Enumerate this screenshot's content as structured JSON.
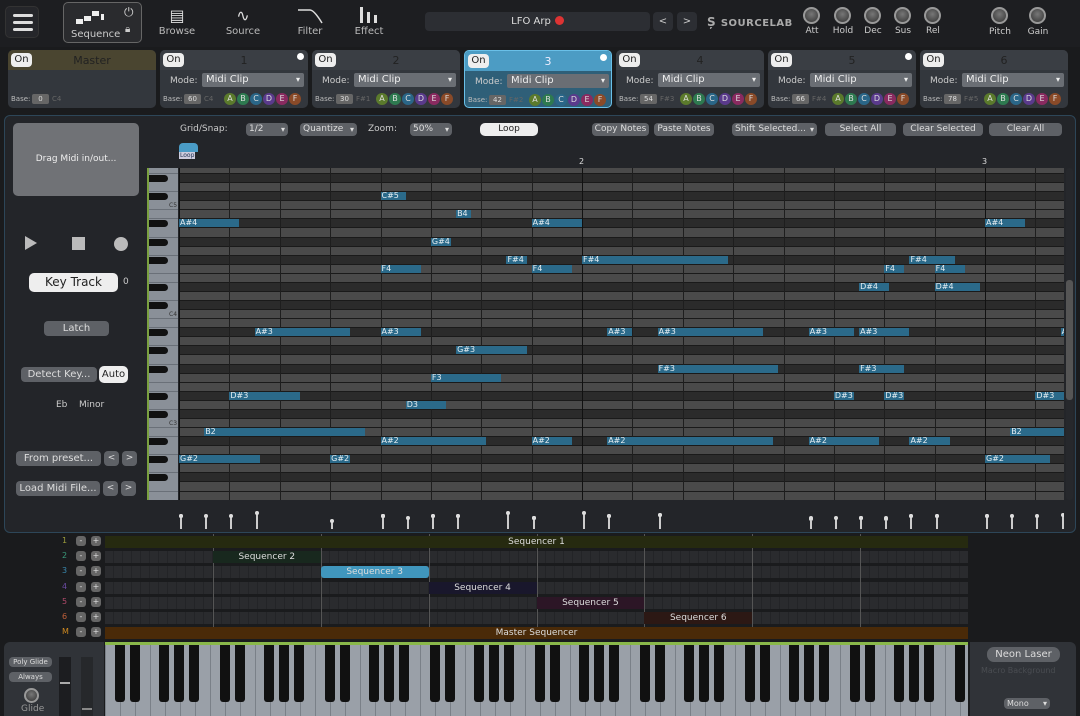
{
  "header": {
    "tabs": [
      {
        "label": "Sequence",
        "icon": "sequence-icon"
      },
      {
        "label": "Browse",
        "icon": "browse-icon"
      },
      {
        "label": "Source",
        "icon": "sine-wave-icon"
      },
      {
        "label": "Filter",
        "icon": "filter-curve-icon"
      },
      {
        "label": "Effect",
        "icon": "bars-icon"
      }
    ],
    "preset": {
      "name": "LFO Arp",
      "prev": "<",
      "next": ">"
    },
    "brand": "SOURCELAB",
    "knobs": [
      "Att",
      "Hold",
      "Dec",
      "Sus",
      "Rel"
    ],
    "knobs2": [
      "Pitch",
      "Gain"
    ]
  },
  "sequencers": [
    {
      "title": "Master",
      "on": "On",
      "base_label": "Base:",
      "base": "0",
      "note": "C4",
      "header_color": "#4a4530"
    },
    {
      "title": "1",
      "on": "On",
      "mode_label": "Mode:",
      "mode": "Midi Clip",
      "base_label": "Base:",
      "base": "60",
      "note": "C4",
      "dot": true
    },
    {
      "title": "2",
      "on": "On",
      "mode_label": "Mode:",
      "mode": "Midi Clip",
      "base_label": "Base:",
      "base": "30",
      "note": "F#1"
    },
    {
      "title": "3",
      "on": "On",
      "mode_label": "Mode:",
      "mode": "Midi Clip",
      "base_label": "Base:",
      "base": "42",
      "note": "F#2",
      "dot": true,
      "selected": true
    },
    {
      "title": "4",
      "on": "On",
      "mode_label": "Mode:",
      "mode": "Midi Clip",
      "base_label": "Base:",
      "base": "54",
      "note": "F#3"
    },
    {
      "title": "5",
      "on": "On",
      "mode_label": "Mode:",
      "mode": "Midi Clip",
      "base_label": "Base:",
      "base": "66",
      "note": "F#4",
      "dot": true
    },
    {
      "title": "6",
      "on": "On",
      "mode_label": "Mode:",
      "mode": "Midi Clip",
      "base_label": "Base:",
      "base": "78",
      "note": "F#5"
    }
  ],
  "letters": [
    {
      "l": "A",
      "c": "#5b7a2c"
    },
    {
      "l": "B",
      "c": "#2e7a50"
    },
    {
      "l": "C",
      "c": "#2a6688"
    },
    {
      "l": "D",
      "c": "#5a3a8c"
    },
    {
      "l": "E",
      "c": "#8a2a60"
    },
    {
      "l": "F",
      "c": "#8a4a28"
    }
  ],
  "left": {
    "drag": "Drag Midi in/out...",
    "key_track": "Key Track",
    "key_track_value": "0",
    "latch": "Latch",
    "detect_key": "Detect Key...",
    "auto": "Auto",
    "key": "Eb",
    "scale": "Minor",
    "from_preset": "From preset...",
    "load_midi": "Load Midi File...",
    "prev": "<",
    "next": ">"
  },
  "toolbar": {
    "grid_label": "Grid/Snap:",
    "grid": "1/2",
    "quantize": "Quantize",
    "zoom_label": "Zoom:",
    "zoom": "50%",
    "loop": "Loop",
    "copy": "Copy Notes",
    "paste": "Paste Notes",
    "shift": "Shift Selected...",
    "select_all": "Select All",
    "clear_selected": "Clear Selected",
    "clear_all": "Clear All"
  },
  "roll": {
    "loop_marker": "Loop",
    "bars": [
      "2",
      "3"
    ],
    "key_labels": [
      "C5",
      "C4",
      "C3"
    ],
    "note_color": "#2b6a8a",
    "notes": [
      {
        "pitch": "C#5",
        "start": 2.0,
        "length": 0.25,
        "vel": 0.8
      },
      {
        "pitch": "B4",
        "start": 2.75,
        "length": 0.15,
        "vel": 0.8
      },
      {
        "pitch": "A#4",
        "start": 0,
        "length": 0.6,
        "vel": 0.8
      },
      {
        "pitch": "A#4",
        "start": 3.5,
        "length": 0.5,
        "vel": 0.7
      },
      {
        "pitch": "A#4",
        "start": 8.0,
        "length": 0.4,
        "vel": 0.8
      },
      {
        "pitch": "G#4",
        "start": 2.5,
        "length": 0.2,
        "vel": 0.8
      },
      {
        "pitch": "F#4",
        "start": 3.25,
        "length": 0.2,
        "vel": 1.0
      },
      {
        "pitch": "F#4",
        "start": 4.0,
        "length": 1.45,
        "vel": 1.0
      },
      {
        "pitch": "F#4",
        "start": 7.25,
        "length": 0.45,
        "vel": 0.8
      },
      {
        "pitch": "F4",
        "start": 2.0,
        "length": 0.4,
        "vel": 0.8
      },
      {
        "pitch": "F4",
        "start": 3.5,
        "length": 0.4,
        "vel": 0.7
      },
      {
        "pitch": "F4",
        "start": 7.0,
        "length": 0.2,
        "vel": 0.6
      },
      {
        "pitch": "F4",
        "start": 7.5,
        "length": 0.3,
        "vel": 0.8
      },
      {
        "pitch": "D#4",
        "start": 6.75,
        "length": 0.3,
        "vel": 0.7
      },
      {
        "pitch": "D#4",
        "start": 7.5,
        "length": 0.45,
        "vel": 0.8
      },
      {
        "pitch": "A#3",
        "start": 0.75,
        "length": 0.95,
        "vel": 1.0
      },
      {
        "pitch": "A#3",
        "start": 2.0,
        "length": 0.4,
        "vel": 0.8
      },
      {
        "pitch": "A#3",
        "start": 4.25,
        "length": 0.25,
        "vel": 0.8
      },
      {
        "pitch": "A#3",
        "start": 4.75,
        "length": 1.05,
        "vel": 0.9
      },
      {
        "pitch": "A#3",
        "start": 6.25,
        "length": 0.45,
        "vel": 0.6
      },
      {
        "pitch": "A#3",
        "start": 6.75,
        "length": 0.5,
        "vel": 0.7
      },
      {
        "pitch": "A#3",
        "start": 8.75,
        "length": 0.1,
        "vel": 0.9
      },
      {
        "pitch": "G#3",
        "start": 2.75,
        "length": 0.7,
        "vel": 0.8
      },
      {
        "pitch": "F#3",
        "start": 4.75,
        "length": 1.2,
        "vel": 0.9
      },
      {
        "pitch": "F#3",
        "start": 6.75,
        "length": 0.45,
        "vel": 0.7
      },
      {
        "pitch": "F3",
        "start": 2.5,
        "length": 0.7,
        "vel": 0.8
      },
      {
        "pitch": "D#3",
        "start": 0.5,
        "length": 0.7,
        "vel": 0.8
      },
      {
        "pitch": "D#3",
        "start": 6.5,
        "length": 0.2,
        "vel": 0.7
      },
      {
        "pitch": "D#3",
        "start": 7.0,
        "length": 0.2,
        "vel": 0.7
      },
      {
        "pitch": "D#3",
        "start": 8.5,
        "length": 0.3,
        "vel": 0.8
      },
      {
        "pitch": "D3",
        "start": 2.25,
        "length": 0.4,
        "vel": 0.7
      },
      {
        "pitch": "B2",
        "start": 0.25,
        "length": 1.6,
        "vel": 0.8
      },
      {
        "pitch": "B2",
        "start": 8.25,
        "length": 0.55,
        "vel": 0.8
      },
      {
        "pitch": "A#2",
        "start": 2.0,
        "length": 1.05,
        "vel": 0.8
      },
      {
        "pitch": "A#2",
        "start": 3.5,
        "length": 0.4,
        "vel": 0.7
      },
      {
        "pitch": "A#2",
        "start": 4.25,
        "length": 1.65,
        "vel": 0.8
      },
      {
        "pitch": "A#2",
        "start": 6.25,
        "length": 0.7,
        "vel": 0.7
      },
      {
        "pitch": "A#2",
        "start": 7.25,
        "length": 0.4,
        "vel": 0.8
      },
      {
        "pitch": "G#2",
        "start": 0,
        "length": 0.8,
        "vel": 0.8
      },
      {
        "pitch": "G#2",
        "start": 1.5,
        "length": 0.2,
        "vel": 0.5
      },
      {
        "pitch": "G#2",
        "start": 8.0,
        "length": 0.65,
        "vel": 0.8
      }
    ]
  },
  "arranger": {
    "rows": [
      {
        "num": "1",
        "color": "#9a9a3a"
      },
      {
        "num": "2",
        "color": "#3a9a7a"
      },
      {
        "num": "3",
        "color": "#3a8ab0"
      },
      {
        "num": "4",
        "color": "#6a4aa0"
      },
      {
        "num": "5",
        "color": "#b04a6a"
      },
      {
        "num": "6",
        "color": "#c0603a"
      },
      {
        "num": "M",
        "color": "#d08a20"
      }
    ],
    "minus": "-",
    "plus": "+",
    "clips": [
      {
        "label": "Sequencer 1",
        "row": 0,
        "start": 0,
        "length": 8,
        "color": "#262a10"
      },
      {
        "label": "Sequencer 2",
        "row": 1,
        "start": 1,
        "length": 1,
        "color": "#18281e"
      },
      {
        "label": "Sequencer 3",
        "row": 2,
        "start": 2,
        "length": 1,
        "color": "#4096bd"
      },
      {
        "label": "Sequencer 4",
        "row": 3,
        "start": 3,
        "length": 1,
        "color": "#19172c"
      },
      {
        "label": "Sequencer 5",
        "row": 4,
        "start": 4,
        "length": 1,
        "color": "#2c1626"
      },
      {
        "label": "Sequencer 6",
        "row": 5,
        "start": 5,
        "length": 1,
        "color": "#2c1814"
      },
      {
        "label": "Master Sequencer",
        "row": 6,
        "start": 0,
        "length": 8,
        "color": "#4a2a08"
      }
    ]
  },
  "bottom": {
    "poly_glide": "Poly Glide",
    "always": "Always",
    "glide": "Glide",
    "macro_name": "Neon Laser",
    "macro_bg": "Macro Background",
    "voice_mode": "Mono"
  }
}
